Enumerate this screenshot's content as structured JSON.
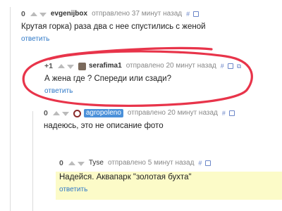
{
  "comments": [
    {
      "rating": "0",
      "author": "evgenijbox",
      "time": "отправлено 37 минут назад",
      "text": "Крутая горка) раза два с нее спустились с женой",
      "reply": "ответить"
    },
    {
      "rating": "+1",
      "author": "serafima1",
      "time": "отправлено 20 минут назад",
      "text": "А жена где ? Спереди или сзади?",
      "reply": "ответить"
    },
    {
      "rating": "0",
      "author": "agropoleno",
      "time": "отправлено 20 минут назад",
      "text": "надеюсь, это не описание фото",
      "reply": null
    },
    {
      "rating": "0",
      "author": "Tyse",
      "time": "отправлено 5 минут назад",
      "text": "Надейся. Аквапарк \"золотая бухта\"",
      "reply": "ответить"
    }
  ],
  "icons": {
    "hash": "#",
    "save": "save-icon"
  },
  "colors": {
    "link": "#2e78c7",
    "highlight": "#fcfbc8",
    "annotation_ring": "#e8344a"
  }
}
